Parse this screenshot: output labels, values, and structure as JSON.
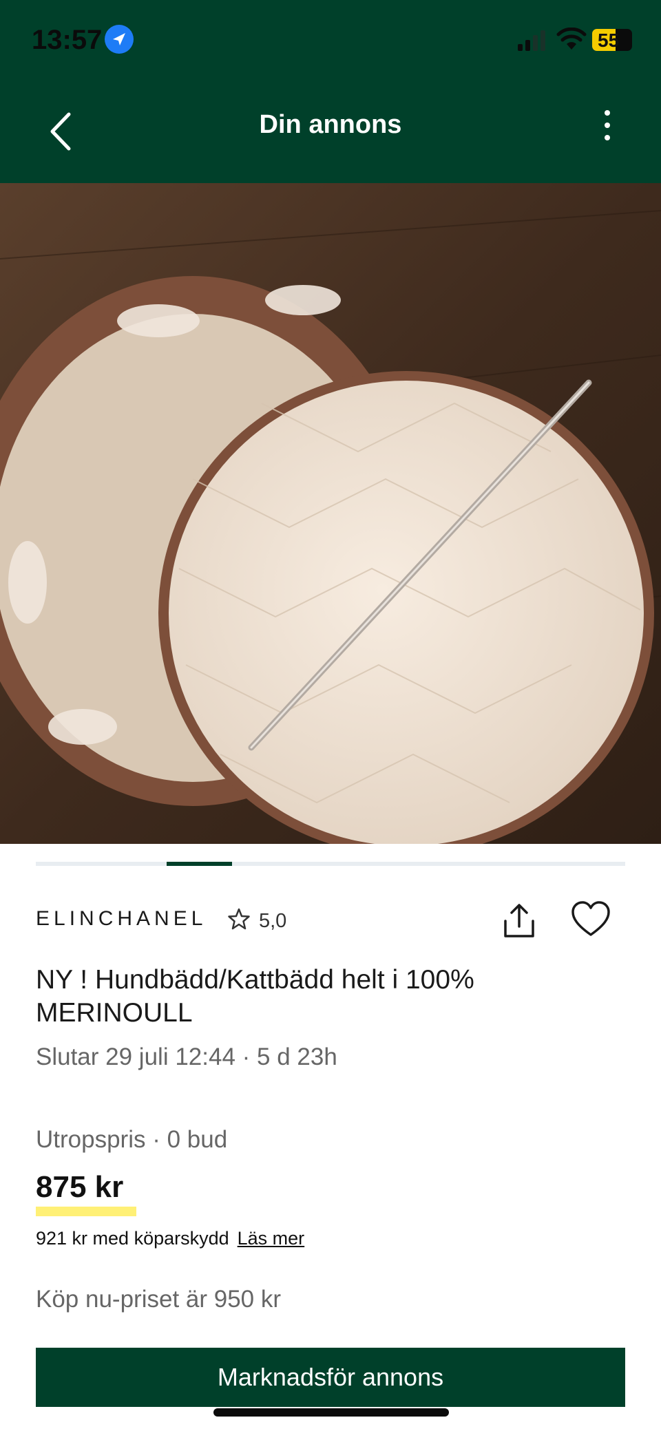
{
  "status_bar": {
    "time": "13:57",
    "battery": "55"
  },
  "header": {
    "title": "Din annons"
  },
  "listing": {
    "seller": "ELINCHANEL",
    "rating": "5,0",
    "title": "NY ! Hundbädd/Kattbädd helt i 100% MERINOULL",
    "ends": "Slutar 29 juli 12:44 · 5 d 23h",
    "price_label": "Utropspris · 0 bud",
    "price": "875 kr",
    "buyer_protection": "921 kr med köparskydd",
    "read_more": "Läs mer",
    "buy_now": "Köp nu-priset är 950 kr"
  },
  "actions": {
    "promote_label": "Marknadsför annons"
  },
  "colors": {
    "brand_green": "#00402a",
    "price_highlight": "#fff076"
  },
  "icons": [
    "back-chevron-icon",
    "more-vertical-icon",
    "star-icon",
    "share-icon",
    "heart-icon",
    "location-arrow-icon",
    "signal-icon",
    "wifi-icon",
    "battery-icon"
  ]
}
